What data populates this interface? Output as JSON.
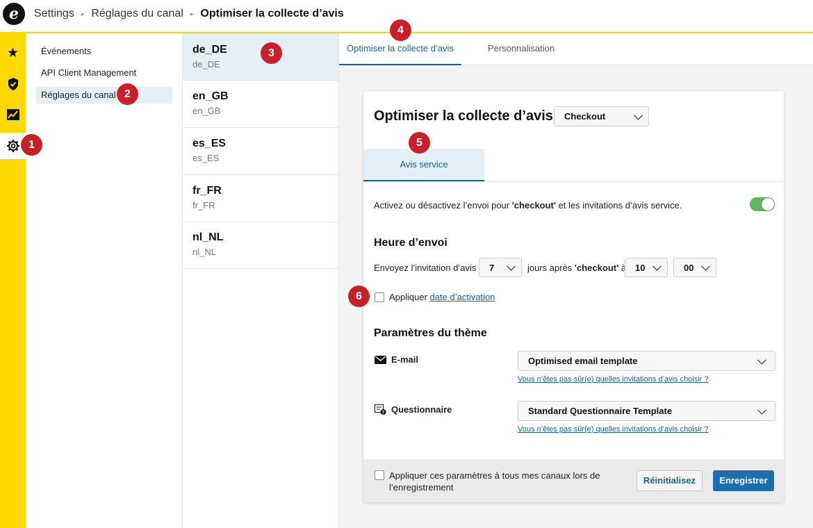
{
  "header": {
    "logo_letter": "e",
    "breadcrumb": [
      "Settings",
      "Réglages du canal"
    ],
    "current": "Optimiser la collecte d’avis"
  },
  "rail": {
    "icons": [
      "star-icon",
      "shield-check-icon",
      "chart-icon",
      "gear-icon"
    ]
  },
  "badges": [
    "1",
    "2",
    "3",
    "4",
    "5",
    "6"
  ],
  "subnav": {
    "items": [
      {
        "label": "Événements"
      },
      {
        "label": "API Client Management"
      },
      {
        "label": "Réglages du canal"
      }
    ]
  },
  "locales": [
    {
      "name": "de_DE",
      "code": "de_DE"
    },
    {
      "name": "en_GB",
      "code": "en_GB"
    },
    {
      "name": "es_ES",
      "code": "es_ES"
    },
    {
      "name": "fr_FR",
      "code": "fr_FR"
    },
    {
      "name": "nl_NL",
      "code": "nl_NL"
    }
  ],
  "tabs": [
    {
      "label": "Optimiser la collecte d’avis"
    },
    {
      "label": "Personnalisation"
    }
  ],
  "card": {
    "title": "Optimiser la collecte d’avis:",
    "event_select": "Checkout",
    "subtab": "Avis service",
    "toggle_text_1": "Activez ou désactivez l’envoi pour ",
    "toggle_text_bold": "'checkout'",
    "toggle_text_2": " et les invitations d’avis service.",
    "toggle_on": true,
    "send_time_heading": "Heure d’envoi",
    "send_text_1": "Envoyez l’invitation d’avis",
    "days_value": "7",
    "send_text_2": "jours après ",
    "send_text_bold": "'checkout'",
    "send_text_3": " à",
    "hour_value": "10",
    "minute_value": "00",
    "activation_text": "Appliquer ",
    "activation_link": "date d’activation",
    "theme_heading": "Paramètres du thème",
    "email_label": "E-mail",
    "email_template": "Optimised email template",
    "help_link": "Vous n’êtes pas sûr(e) quelles invitations d’avis choisir ?",
    "questionnaire_label": "Questionnaire",
    "questionnaire_template": "Standard Questionnaire Template",
    "help_link_2": "Vous n’êtes pas sûr(e) quelles invitations d’avis choisir ?",
    "apply_all_text": "Appliquer ces paramètres à tous mes canaux lors de l’enregistrement",
    "reset_label": "Réinitialisez",
    "save_label": "Enregistrer"
  },
  "colors": {
    "brand_yellow": "#fcd900",
    "accent_blue": "#1a5e95",
    "badge_red": "#c8202a",
    "toggle_green": "#5cb85c"
  }
}
